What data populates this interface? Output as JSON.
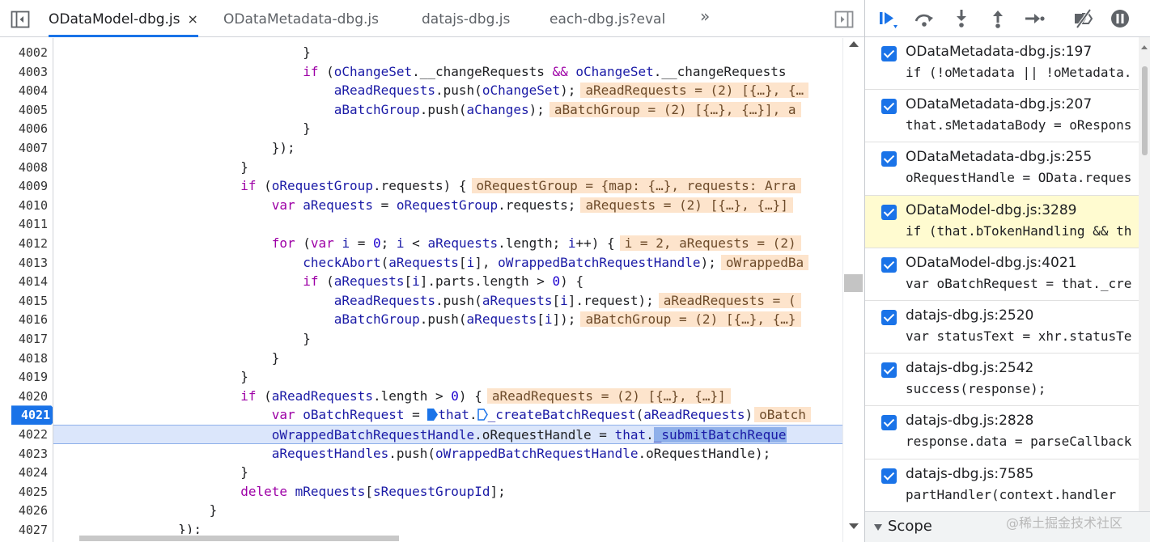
{
  "tabs": [
    {
      "label": "ODataModel-dbg.js",
      "active": true,
      "close": "×"
    },
    {
      "label": "ODataMetadata-dbg.js",
      "active": false
    },
    {
      "label": "datajs-dbg.js",
      "active": false
    },
    {
      "label": "each-dbg.js?eval",
      "active": false
    }
  ],
  "more_tabs": "»",
  "lines": [
    {
      "num": "4002"
    },
    {
      "num": "4003"
    },
    {
      "num": "4004"
    },
    {
      "num": "4005"
    },
    {
      "num": "4006"
    },
    {
      "num": "4007"
    },
    {
      "num": "4008"
    },
    {
      "num": "4009"
    },
    {
      "num": "4010"
    },
    {
      "num": "4011"
    },
    {
      "num": "4012"
    },
    {
      "num": "4013"
    },
    {
      "num": "4014"
    },
    {
      "num": "4015"
    },
    {
      "num": "4016"
    },
    {
      "num": "4017"
    },
    {
      "num": "4018"
    },
    {
      "num": "4019"
    },
    {
      "num": "4020"
    },
    {
      "num": "4021"
    },
    {
      "num": "4022"
    },
    {
      "num": "4023"
    },
    {
      "num": "4024"
    },
    {
      "num": "4025"
    },
    {
      "num": "4026"
    },
    {
      "num": "4027"
    }
  ],
  "code": {
    "l4003_a": "aReadRequests = (2) [{…}, {…",
    "l4005_a": "aBatchGroup = (2) [{…}, {…}], a",
    "l4009_a": "oRequestGroup = {map: {…}, requests: Arra",
    "l4010_a": "aRequests = (2) [{…}, {…}]",
    "l4012_a": "i = 2, aRequests = (2)",
    "l4013_a": "oWrappedBa",
    "l4015_a": "aReadRequests = (",
    "l4016_a": "aBatchGroup = (2) [{…}, {…}",
    "l4020_a": "aReadRequests = (2) [{…}, {…}]",
    "l4021_a": "oBatch"
  },
  "breakpoints": [
    {
      "file": "ODataMetadata-dbg.js:197",
      "code": "if (!oMetadata || !oMetadata.",
      "highlight": false
    },
    {
      "file": "ODataMetadata-dbg.js:207",
      "code": "that.sMetadataBody = oRespons",
      "highlight": false
    },
    {
      "file": "ODataMetadata-dbg.js:255",
      "code": "oRequestHandle = OData.reques",
      "highlight": false
    },
    {
      "file": "ODataModel-dbg.js:3289",
      "code": "if (that.bTokenHandling && th",
      "highlight": true
    },
    {
      "file": "ODataModel-dbg.js:4021",
      "code": "var oBatchRequest = that._cre",
      "highlight": false
    },
    {
      "file": "datajs-dbg.js:2520",
      "code": "var statusText = xhr.statusTe",
      "highlight": false
    },
    {
      "file": "datajs-dbg.js:2542",
      "code": "success(response);",
      "highlight": false
    },
    {
      "file": "datajs-dbg.js:2828",
      "code": "response.data = parseCallback",
      "highlight": false
    },
    {
      "file": "datajs-dbg.js:7585",
      "code": "partHandler(context.handler",
      "highlight": false
    }
  ],
  "scope": {
    "label": "Scope"
  },
  "watermark": "@稀土掘金技术社区",
  "colors": {
    "accent": "#1a73e8",
    "inline_value_bg": "#fde4cc",
    "exec_line_bg": "#dbe6fb",
    "keyword": "#9d00a6"
  }
}
